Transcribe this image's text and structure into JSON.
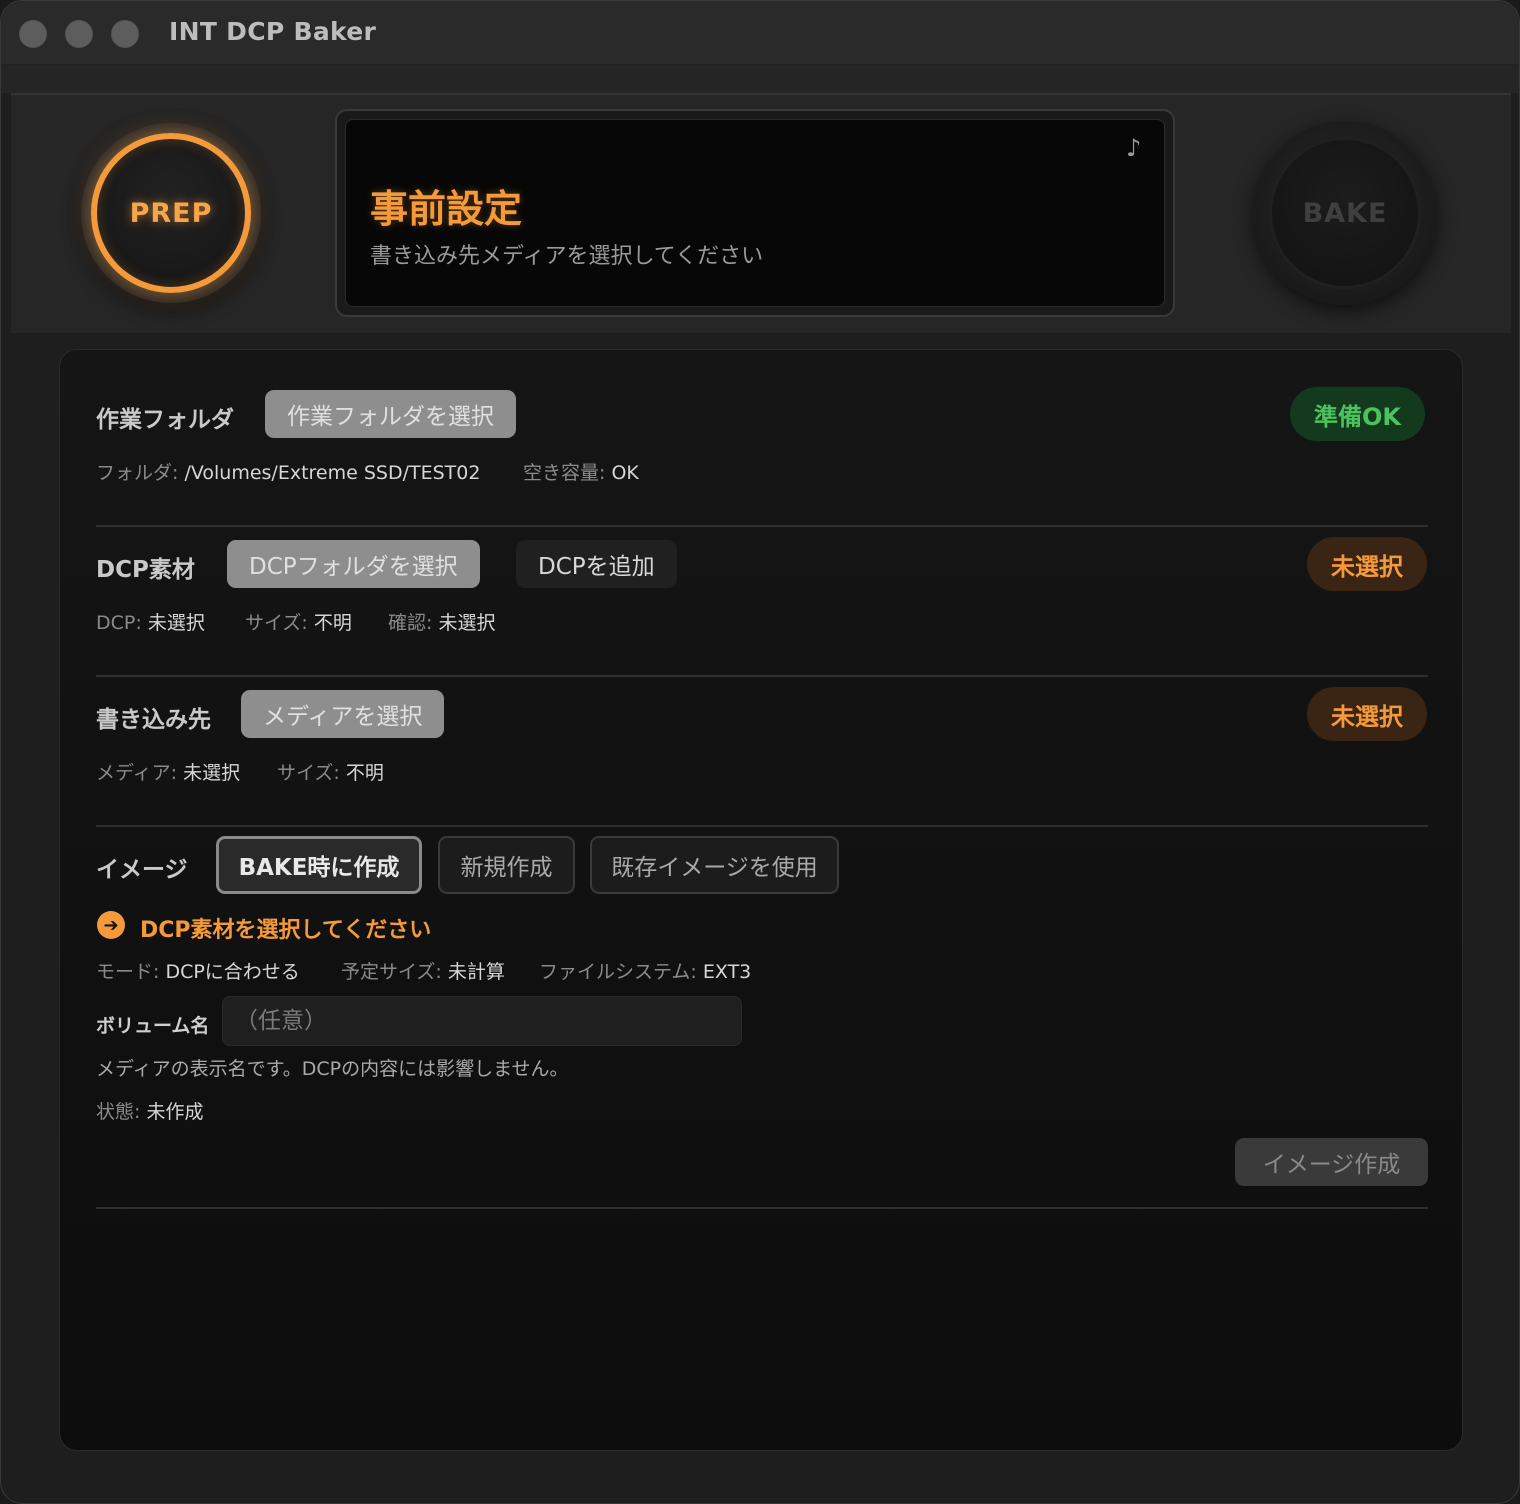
{
  "window": {
    "title": "INT DCP Baker"
  },
  "header": {
    "prep_label": "PREP",
    "bake_label": "BAKE",
    "lcd": {
      "title": "事前設定",
      "subtitle": "書き込み先メディアを選択してください",
      "note_icon": "♪"
    }
  },
  "sections": {
    "workfolder": {
      "label": "作業フォルダ",
      "select_button": "作業フォルダを選択",
      "status": "準備OK",
      "info": [
        {
          "key": "フォルダ:",
          "value": "/Volumes/Extreme SSD/TEST02"
        },
        {
          "key": "空き容量:",
          "value": "OK"
        }
      ]
    },
    "dcp": {
      "label": "DCP素材",
      "select_button": "DCPフォルダを選択",
      "add_button": "DCPを追加",
      "status": "未選択",
      "info": [
        {
          "key": "DCP:",
          "value": "未選択"
        },
        {
          "key": "サイズ:",
          "value": "不明"
        },
        {
          "key": "確認:",
          "value": "未選択"
        }
      ]
    },
    "destination": {
      "label": "書き込み先",
      "select_button": "メディアを選択",
      "status": "未選択",
      "info": [
        {
          "key": "メディア:",
          "value": "未選択"
        },
        {
          "key": "サイズ:",
          "value": "不明"
        }
      ]
    },
    "image": {
      "label": "イメージ",
      "modes": [
        "BAKE時に作成",
        "新規作成",
        "既存イメージを使用"
      ],
      "active_mode": "BAKE時に作成",
      "hint": "DCP素材を選択してください",
      "info": [
        {
          "key": "モード:",
          "value": "DCPに合わせる"
        },
        {
          "key": "予定サイズ:",
          "value": "未計算"
        },
        {
          "key": "ファイルシステム:",
          "value": "EXT3"
        }
      ],
      "volume_label": "ボリューム名",
      "volume_value": "",
      "volume_placeholder": "（任意）",
      "volume_help": "メディアの表示名です。DCPの内容には影響しません。",
      "state_key": "状態:",
      "state_value": "未作成",
      "create_button": "イメージ作成"
    }
  },
  "colors": {
    "accent": "#f59a3a",
    "ok": "#4cc15f",
    "background": "#1e1e1e"
  }
}
